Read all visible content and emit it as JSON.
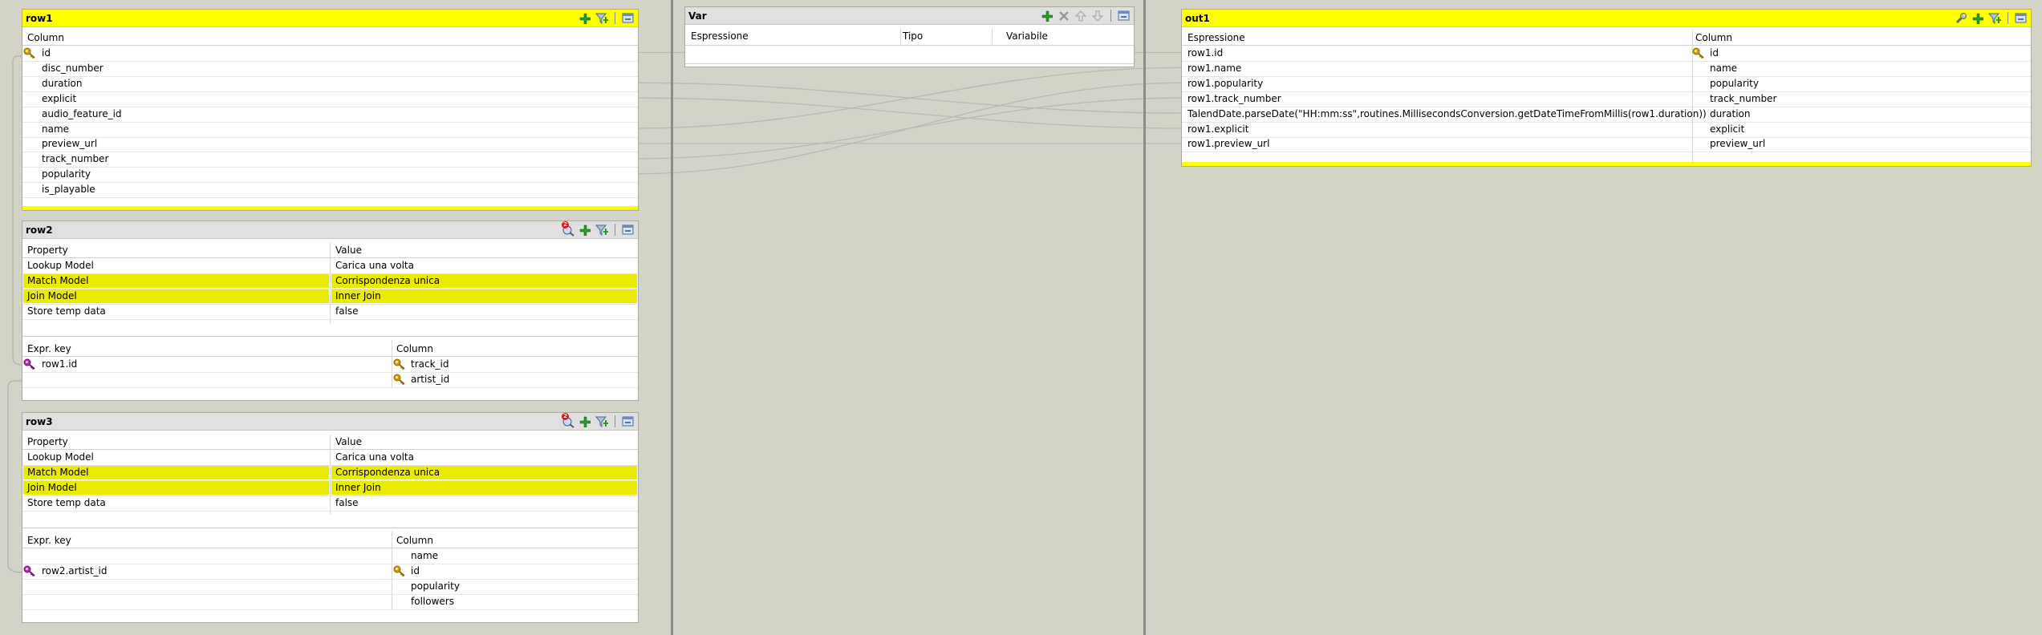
{
  "row1": {
    "title": "row1",
    "column_header": "Column",
    "columns": [
      "id",
      "disc_number",
      "duration",
      "explicit",
      "audio_feature_id",
      "name",
      "preview_url",
      "track_number",
      "popularity",
      "is_playable"
    ]
  },
  "row2": {
    "title": "row2",
    "badge": "2",
    "property_header": "Property",
    "value_header": "Value",
    "properties": [
      {
        "name": "Lookup Model",
        "value": "Carica una volta",
        "highlight": false
      },
      {
        "name": "Match Model",
        "value": "Corrispondenza unica",
        "highlight": true
      },
      {
        "name": "Join Model",
        "value": "Inner Join",
        "highlight": true
      },
      {
        "name": "Store temp data",
        "value": "false",
        "highlight": false
      }
    ],
    "expr_header": "Expr. key",
    "column_header": "Column",
    "rows": [
      {
        "expr": "row1.id",
        "column": "track_id",
        "key": true
      },
      {
        "expr": "",
        "column": "artist_id",
        "key": true
      }
    ]
  },
  "row3": {
    "title": "row3",
    "badge": "2",
    "property_header": "Property",
    "value_header": "Value",
    "properties": [
      {
        "name": "Lookup Model",
        "value": "Carica una volta",
        "highlight": false
      },
      {
        "name": "Match Model",
        "value": "Corrispondenza unica",
        "highlight": true
      },
      {
        "name": "Join Model",
        "value": "Inner Join",
        "highlight": true
      },
      {
        "name": "Store temp data",
        "value": "false",
        "highlight": false
      }
    ],
    "expr_header": "Expr. key",
    "column_header": "Column",
    "rows": [
      {
        "expr": "",
        "column": "name",
        "key": false
      },
      {
        "expr": "row2.artist_id",
        "column": "id",
        "key": true
      },
      {
        "expr": "",
        "column": "popularity",
        "key": false
      },
      {
        "expr": "",
        "column": "followers",
        "key": false
      }
    ]
  },
  "var": {
    "title": "Var",
    "col_expr": "Espressione",
    "col_type": "Tipo",
    "col_var": "Variabile"
  },
  "out1": {
    "title": "out1",
    "col_expr": "Espressione",
    "col_column": "Column",
    "rows": [
      {
        "expr": "row1.id",
        "column": "id",
        "key": true
      },
      {
        "expr": "row1.name",
        "column": "name",
        "key": false
      },
      {
        "expr": "row1.popularity",
        "column": "popularity",
        "key": false
      },
      {
        "expr": "row1.track_number",
        "column": "track_number",
        "key": false
      },
      {
        "expr": "TalendDate.parseDate(\"HH:mm:ss\",routines.MillisecondsConversion.getDateTimeFromMillis(row1.duration))",
        "column": "duration",
        "key": false
      },
      {
        "expr": "row1.explicit",
        "column": "explicit",
        "key": false
      },
      {
        "expr": "row1.preview_url",
        "column": "preview_url",
        "key": false
      }
    ]
  },
  "colors": {
    "header_yellow": "#ffff00",
    "highlight_yellow": "#ebeb00",
    "background": "#d4d3c8",
    "key_purple": "#b030b0",
    "key_gold": "#d4a000"
  },
  "mappings": [
    {
      "from": "id",
      "to": "id"
    },
    {
      "from": "duration",
      "to": "duration"
    },
    {
      "from": "explicit",
      "to": "explicit"
    },
    {
      "from": "name",
      "to": "name"
    },
    {
      "from": "preview_url",
      "to": "preview_url"
    },
    {
      "from": "track_number",
      "to": "track_number"
    },
    {
      "from": "popularity",
      "to": "popularity"
    }
  ]
}
